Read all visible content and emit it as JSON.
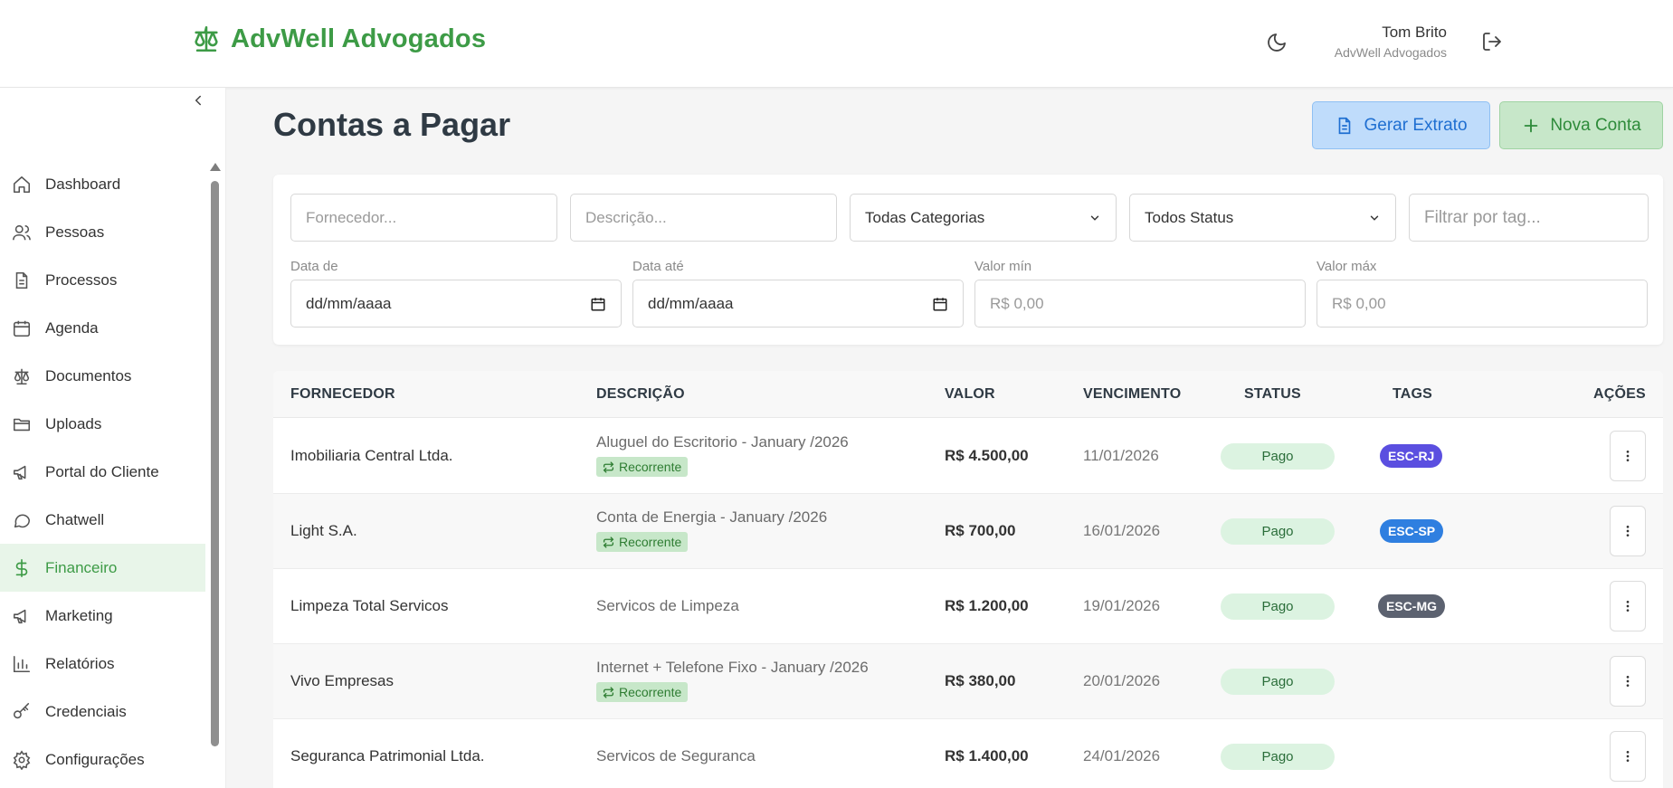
{
  "header": {
    "brand": "AdvWell Advogados",
    "user_name": "Tom Brito",
    "user_firm": "AdvWell Advogados",
    "accent": "#3d9b46"
  },
  "sidebar": {
    "items": [
      {
        "label": "Dashboard",
        "icon": "home-icon"
      },
      {
        "label": "Pessoas",
        "icon": "users-icon"
      },
      {
        "label": "Processos",
        "icon": "document-icon"
      },
      {
        "label": "Agenda",
        "icon": "calendar-icon"
      },
      {
        "label": "Documentos",
        "icon": "scale-icon"
      },
      {
        "label": "Uploads",
        "icon": "folder-icon"
      },
      {
        "label": "Portal do Cliente",
        "icon": "megaphone-icon"
      },
      {
        "label": "Chatwell",
        "icon": "chat-icon"
      },
      {
        "label": "Financeiro",
        "icon": "dollar-icon",
        "active": true
      },
      {
        "label": "Marketing",
        "icon": "megaphone-icon"
      },
      {
        "label": "Relatórios",
        "icon": "bar-chart-icon"
      },
      {
        "label": "Credenciais",
        "icon": "key-icon"
      },
      {
        "label": "Configurações",
        "icon": "gear-icon"
      }
    ]
  },
  "page": {
    "title": "Contas a Pagar",
    "btn_extrato": "Gerar Extrato",
    "btn_nova": "Nova Conta"
  },
  "filters": {
    "fornecedor_placeholder": "Fornecedor...",
    "descricao_placeholder": "Descrição...",
    "categoria_value": "Todas Categorias",
    "status_value": "Todos Status",
    "tag_placeholder": "Filtrar por tag...",
    "data_de_label": "Data de",
    "data_de_value": "dd/mm/aaaa",
    "data_ate_label": "Data até",
    "data_ate_value": "dd/mm/aaaa",
    "valor_min_label": "Valor mín",
    "valor_min_placeholder": "R$ 0,00",
    "valor_max_label": "Valor máx",
    "valor_max_placeholder": "R$ 0,00"
  },
  "table": {
    "headers": [
      "FORNECEDOR",
      "DESCRIÇÃO",
      "VALOR",
      "VENCIMENTO",
      "STATUS",
      "TAGS",
      "AÇÕES"
    ],
    "recurrent_label": "Recorrente",
    "rows": [
      {
        "fornecedor": "Imobiliaria Central Ltda.",
        "descricao": "Aluguel do Escritorio - January /2026",
        "recorrente": true,
        "valor": "R$ 4.500,00",
        "vencimento": "11/01/2026",
        "status": "Pago",
        "tag": "ESC-RJ",
        "tag_color": "#5b4fe0"
      },
      {
        "fornecedor": "Light S.A.",
        "descricao": "Conta de Energia - January /2026",
        "recorrente": true,
        "valor": "R$ 700,00",
        "vencimento": "16/01/2026",
        "status": "Pago",
        "tag": "ESC-SP",
        "tag_color": "#2f7fe0"
      },
      {
        "fornecedor": "Limpeza Total Servicos",
        "descricao": "Servicos de Limpeza",
        "recorrente": false,
        "valor": "R$ 1.200,00",
        "vencimento": "19/01/2026",
        "status": "Pago",
        "tag": "ESC-MG",
        "tag_color": "#5c6270"
      },
      {
        "fornecedor": "Vivo Empresas",
        "descricao": "Internet + Telefone Fixo - January /2026",
        "recorrente": true,
        "valor": "R$ 380,00",
        "vencimento": "20/01/2026",
        "status": "Pago",
        "tag": "",
        "tag_color": ""
      },
      {
        "fornecedor": "Seguranca Patrimonial Ltda.",
        "descricao": "Servicos de Seguranca",
        "recorrente": false,
        "valor": "R$ 1.400,00",
        "vencimento": "24/01/2026",
        "status": "Pago",
        "tag": "",
        "tag_color": ""
      }
    ]
  }
}
